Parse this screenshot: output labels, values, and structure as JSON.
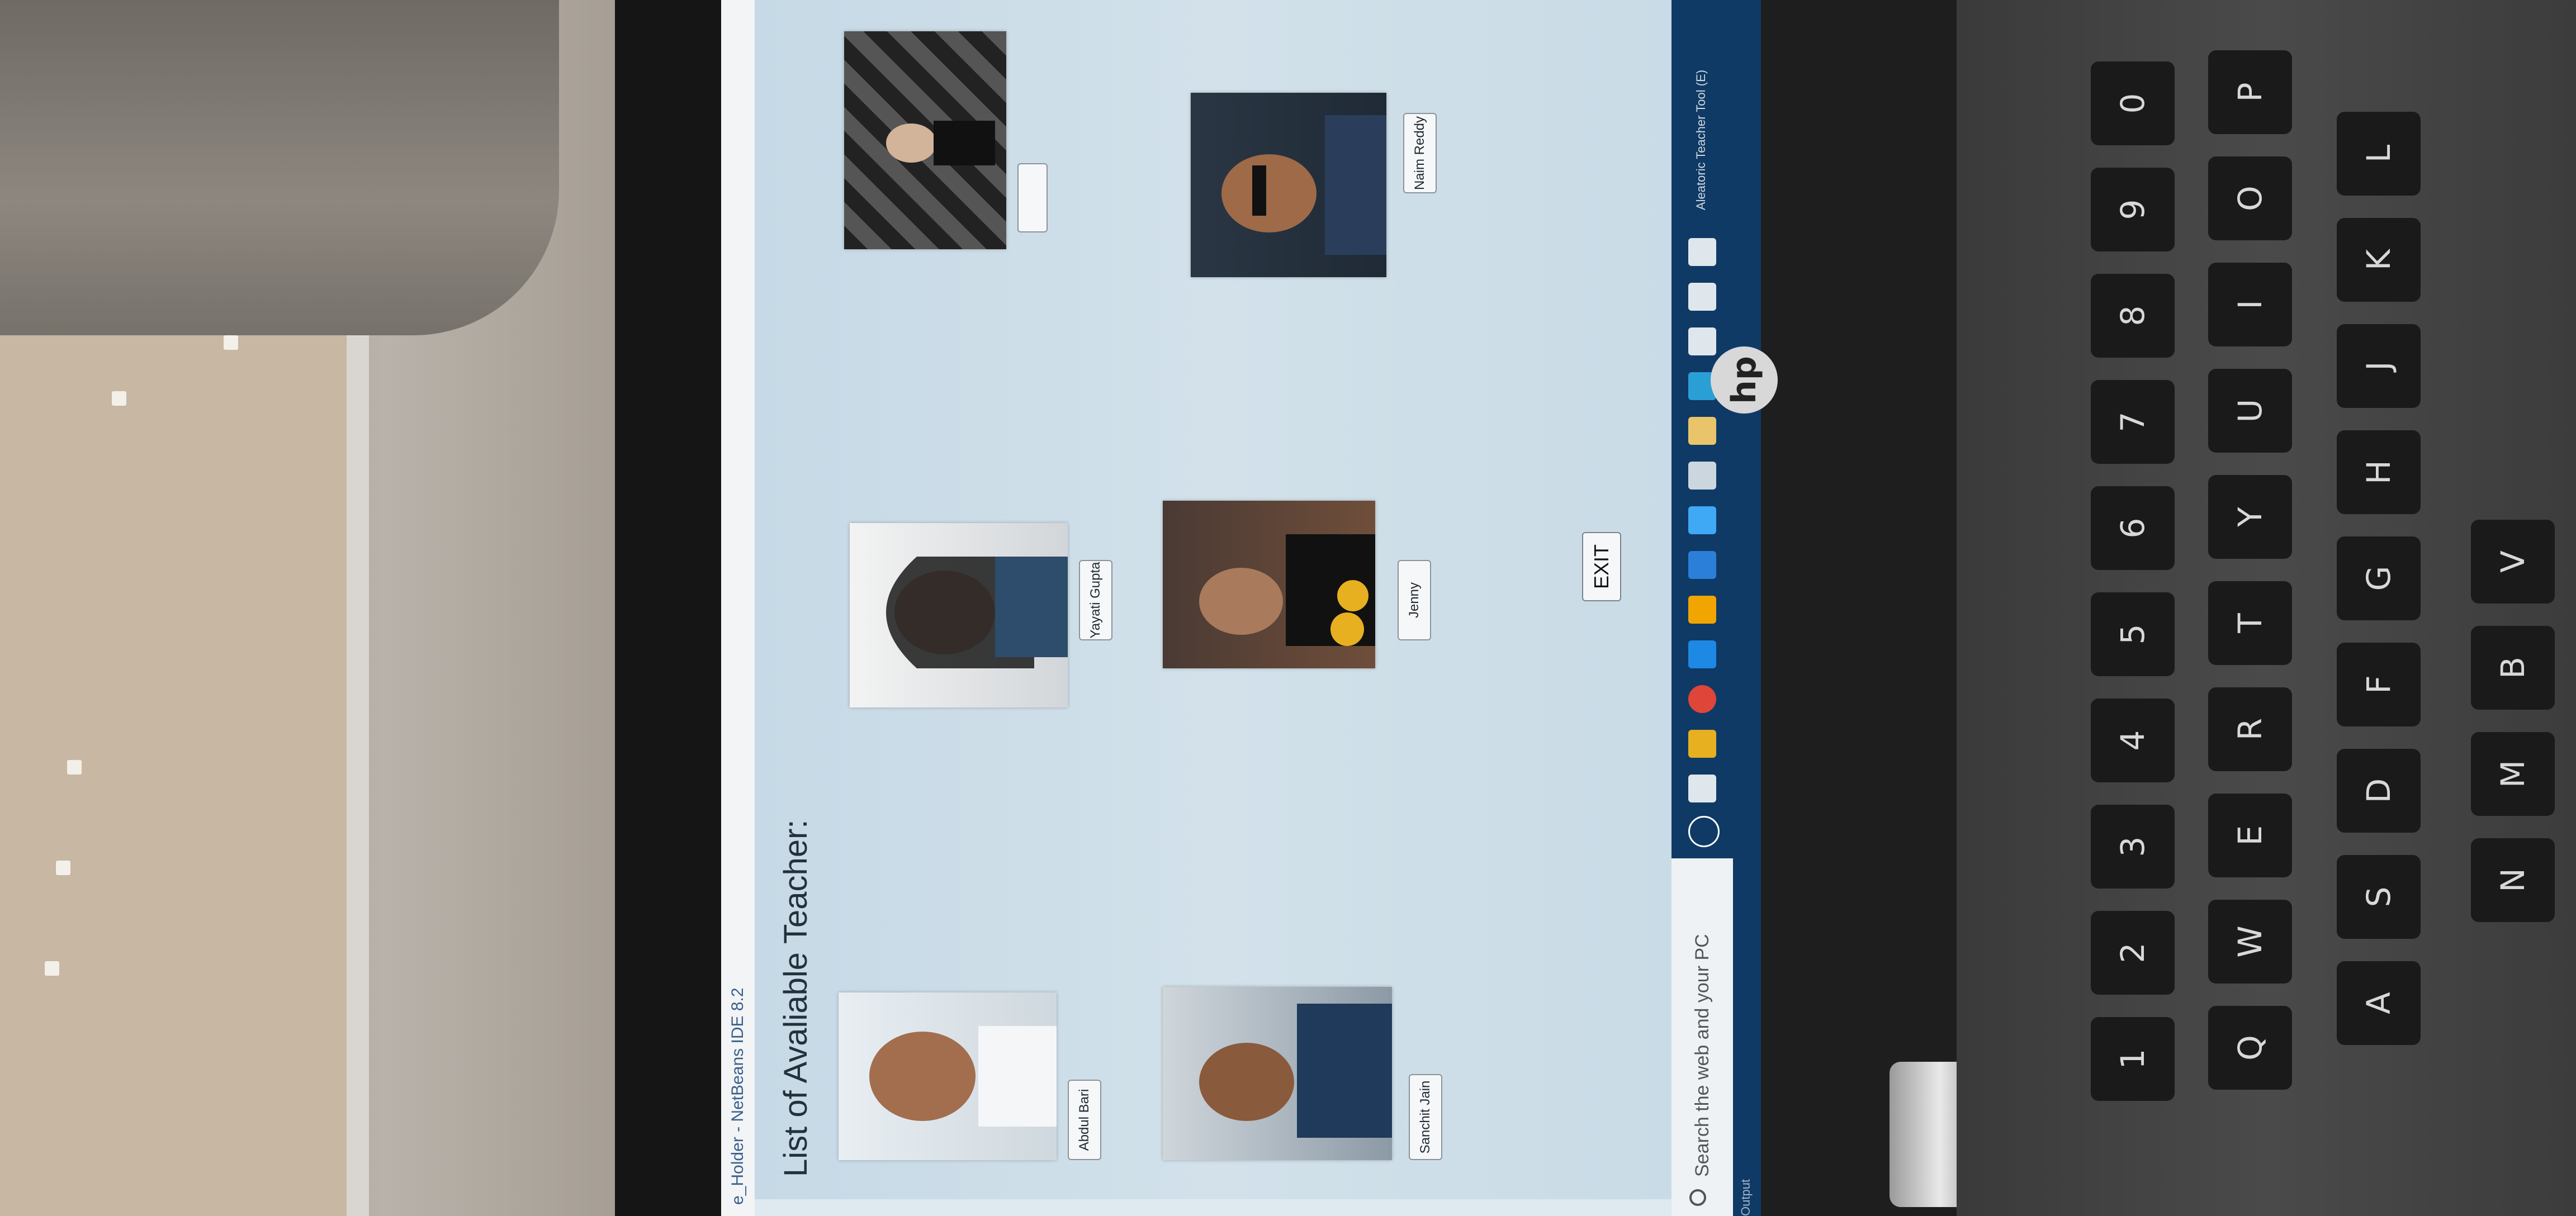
{
  "window": {
    "title": "e_Holder - NetBeans IDE 8.2"
  },
  "app": {
    "heading": "List of Avaliable Teacher:",
    "teachers": [
      {
        "name": "Abdul Bari"
      },
      {
        "name": "Sanchit Jain"
      },
      {
        "name": "Yayati Gupta"
      },
      {
        "name": "Jenny"
      },
      {
        "name": ""
      },
      {
        "name": "Naim Reddy"
      }
    ],
    "exit_label": "EXIT"
  },
  "taskbar": {
    "search_placeholder": "Search the web and your PC",
    "output_label": "Output",
    "notification_text": "Aleatoric Teacher Tool (E)"
  },
  "keyboard": {
    "keys": [
      "1",
      "2",
      "3",
      "4",
      "5",
      "6",
      "7",
      "8",
      "9",
      "0",
      "Q",
      "W",
      "E",
      "R",
      "T",
      "Y",
      "U",
      "I",
      "O",
      "P",
      "A",
      "S",
      "D",
      "F",
      "G",
      "H",
      "J",
      "K",
      "L",
      "N",
      "M",
      "B",
      "V"
    ]
  },
  "brand": {
    "logo_text": "hp"
  },
  "colors": {
    "screen_bg": "#c6d9e6",
    "taskbar": "#0f3a66",
    "bezel": "#151515"
  }
}
